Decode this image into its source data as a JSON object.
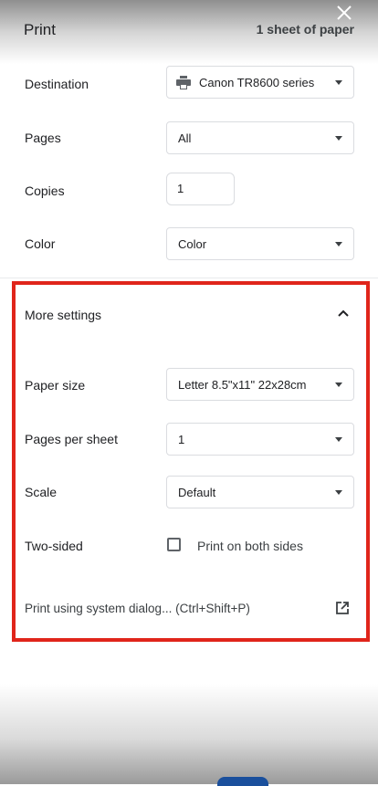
{
  "dialog": {
    "title": "Print",
    "sheet_summary": "1 sheet of paper"
  },
  "destination": {
    "label": "Destination",
    "value": "Canon TR8600 series"
  },
  "pages": {
    "label": "Pages",
    "value": "All"
  },
  "copies": {
    "label": "Copies",
    "value": "1"
  },
  "color": {
    "label": "Color",
    "value": "Color"
  },
  "more_settings": {
    "label": "More settings",
    "expanded": true,
    "paper_size": {
      "label": "Paper size",
      "value": "Letter 8.5\"x11\" 22x28cm"
    },
    "pages_per_sheet": {
      "label": "Pages per sheet",
      "value": "1"
    },
    "scale": {
      "label": "Scale",
      "value": "Default"
    },
    "two_sided": {
      "label": "Two-sided",
      "checkbox_label": "Print on both sides",
      "checked": false
    },
    "system_dialog": {
      "label": "Print using system dialog... (Ctrl+Shift+P)"
    }
  },
  "colors": {
    "highlight": "#e0251b",
    "border": "#dadce0",
    "text": "#202124"
  },
  "icons": [
    "close-icon",
    "printer-icon",
    "chevron-down-icon",
    "chevron-up-icon",
    "open-in-new-icon"
  ]
}
